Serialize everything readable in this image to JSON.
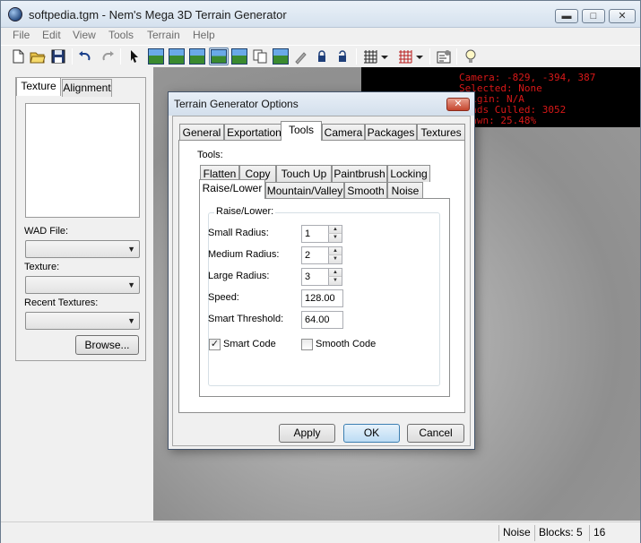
{
  "window": {
    "title": "softpedia.tgm - Nem's Mega 3D Terrain Generator",
    "buttons": {
      "minimize": "▬",
      "maximize": "□",
      "close": "✕"
    }
  },
  "menu": [
    "File",
    "Edit",
    "View",
    "Tools",
    "Terrain",
    "Help"
  ],
  "toolbar": {
    "icons": [
      "new-file-icon",
      "open-folder-icon",
      "save-icon",
      "undo-icon",
      "redo-icon",
      "select-arrow-icon",
      "terrain-view-1-icon",
      "terrain-view-2-icon",
      "terrain-view-3-icon",
      "terrain-view-4-icon",
      "terrain-view-5-icon",
      "copy-icon",
      "terrain-view-6-icon",
      "paint-brush-icon",
      "lock-icon",
      "unlock-icon",
      "grid-icon",
      "grid-red-icon",
      "properties-icon",
      "lightbulb-icon"
    ]
  },
  "left_panel": {
    "tabs": [
      "Texture",
      "Alignment"
    ],
    "wad_file_label": "WAD File:",
    "texture_label": "Texture:",
    "recent_textures_label": "Recent Textures:",
    "browse_label": "Browse..."
  },
  "hud": {
    "lines": [
      "Camera: -829, -394, 387",
      "Selected: None",
      "Origin: N/A",
      "Quads Culled: 3052",
      "Drawn: 25.48%"
    ]
  },
  "status": {
    "mode": "Noise",
    "blocks": "Blocks: 5",
    "count": "16"
  },
  "dialog": {
    "title": "Terrain Generator Options",
    "close": "✕",
    "tabs": [
      "General",
      "Exportation",
      "Tools",
      "Camera",
      "Packages",
      "Textures"
    ],
    "active_tab": "Tools",
    "tools_label": "Tools:",
    "tool_tabs_row1": [
      "Flatten",
      "Copy",
      "Touch Up",
      "Paintbrush",
      "Locking"
    ],
    "tool_tabs_row2": [
      "Raise/Lower",
      "Mountain/Valley",
      "Smooth",
      "Noise"
    ],
    "active_tool": "Raise/Lower",
    "group_label": "Raise/Lower:",
    "small_radius_label": "Small Radius:",
    "small_radius": "1",
    "medium_radius_label": "Medium Radius:",
    "medium_radius": "2",
    "large_radius_label": "Large Radius:",
    "large_radius": "3",
    "speed_label": "Speed:",
    "speed": "128.00",
    "smart_threshold_label": "Smart Threshold:",
    "smart_threshold": "64.00",
    "smart_code_label": "Smart Code",
    "smart_code_checked": "✓",
    "smooth_code_label": "Smooth Code",
    "apply": "Apply",
    "ok": "OK",
    "cancel": "Cancel"
  },
  "colors": {
    "hud_text": "#d81818",
    "viewport_gray": "#a9a9a9"
  }
}
